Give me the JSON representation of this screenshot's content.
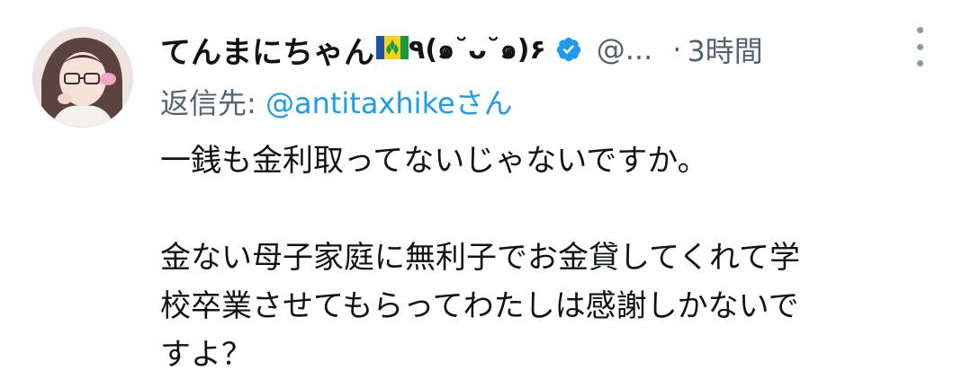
{
  "tweet": {
    "display_name": "てんまにちゃん",
    "kaomoji": "٩(๑˘ᴗ˘๑)۶",
    "handle": "@...",
    "separator": "·",
    "time": "3時間",
    "reply_prefix": "返信先: ",
    "reply_handle": "@antitaxhike",
    "reply_suffix": "さん",
    "body": {
      "paragraph_1": "一銭も金利取ってないじゃないですか。",
      "paragraph_2_line_1": "金ない母子家庭に無利子でお金貸してくれて学",
      "paragraph_2_line_2": "校卒業させてもらってわたしは感謝しかないで",
      "paragraph_2_line_3": "すよ？"
    }
  },
  "icons": {
    "verified": "verified-badge-icon",
    "flag": "saint-vincent-flag-icon",
    "more": "more-vertical-icon"
  },
  "colors": {
    "text_primary": "#0f1419",
    "text_secondary": "#536471",
    "accent": "#1d9bf0"
  }
}
